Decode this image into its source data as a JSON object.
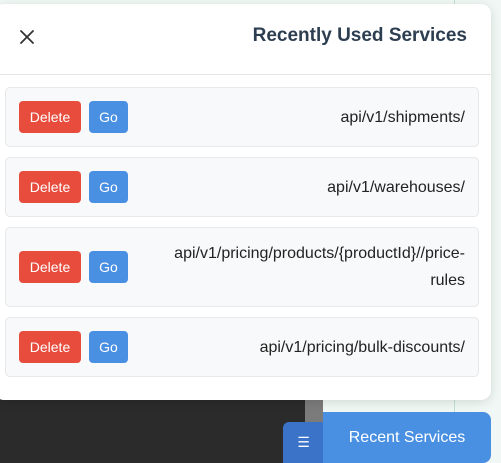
{
  "panel": {
    "title": "Recently Used Services",
    "items": [
      {
        "delete_label": "Delete",
        "go_label": "Go",
        "path": "api/v1/shipments/"
      },
      {
        "delete_label": "Delete",
        "go_label": "Go",
        "path": "api/v1/warehouses/"
      },
      {
        "delete_label": "Delete",
        "go_label": "Go",
        "path": "api/v1/pricing/products/{productId}//price-rules"
      },
      {
        "delete_label": "Delete",
        "go_label": "Go",
        "path": "api/v1/pricing/bulk-discounts/"
      }
    ]
  },
  "floating": {
    "toggle_icon": "☰",
    "recent_label": "Recent Services"
  },
  "colors": {
    "delete": "#e74c3c",
    "go": "#4a90e2",
    "title": "#2c3e50",
    "recent_button": "#4a90e2"
  },
  "icons": {
    "close": "close-icon",
    "toggle": "menu-icon"
  }
}
